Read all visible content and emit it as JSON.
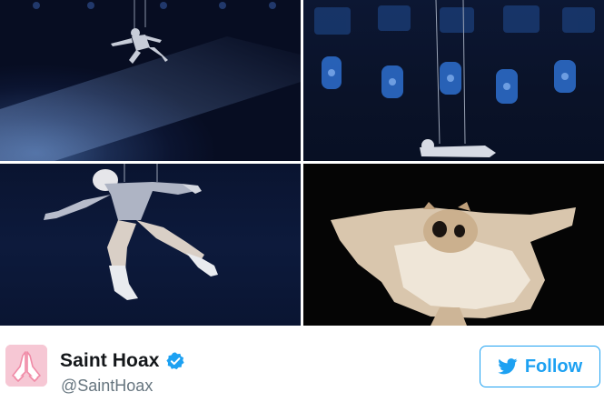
{
  "tweet": {
    "photo_grid": [
      {
        "description": "performer suspended on wires against a stage spotlight"
      },
      {
        "description": "performer lying flat, lowered on wires beneath stage lights"
      },
      {
        "description": "performer leaping mid-air in sequined jacket and boots"
      },
      {
        "description": "flying squirrel gliding with limbs outstretched"
      }
    ],
    "author": {
      "display_name": "Saint Hoax",
      "handle": "@SaintHoax",
      "verified": true
    },
    "follow_button": {
      "label": "Follow"
    }
  },
  "colors": {
    "brand_blue": "#1da1f2",
    "name_text": "#14171a",
    "handle_text": "#66757f",
    "avatar_bg": "#f6c7d4"
  },
  "icons": {
    "avatar": "praying-hands-icon",
    "verified": "verified-badge-icon",
    "follow": "twitter-bird-icon"
  }
}
